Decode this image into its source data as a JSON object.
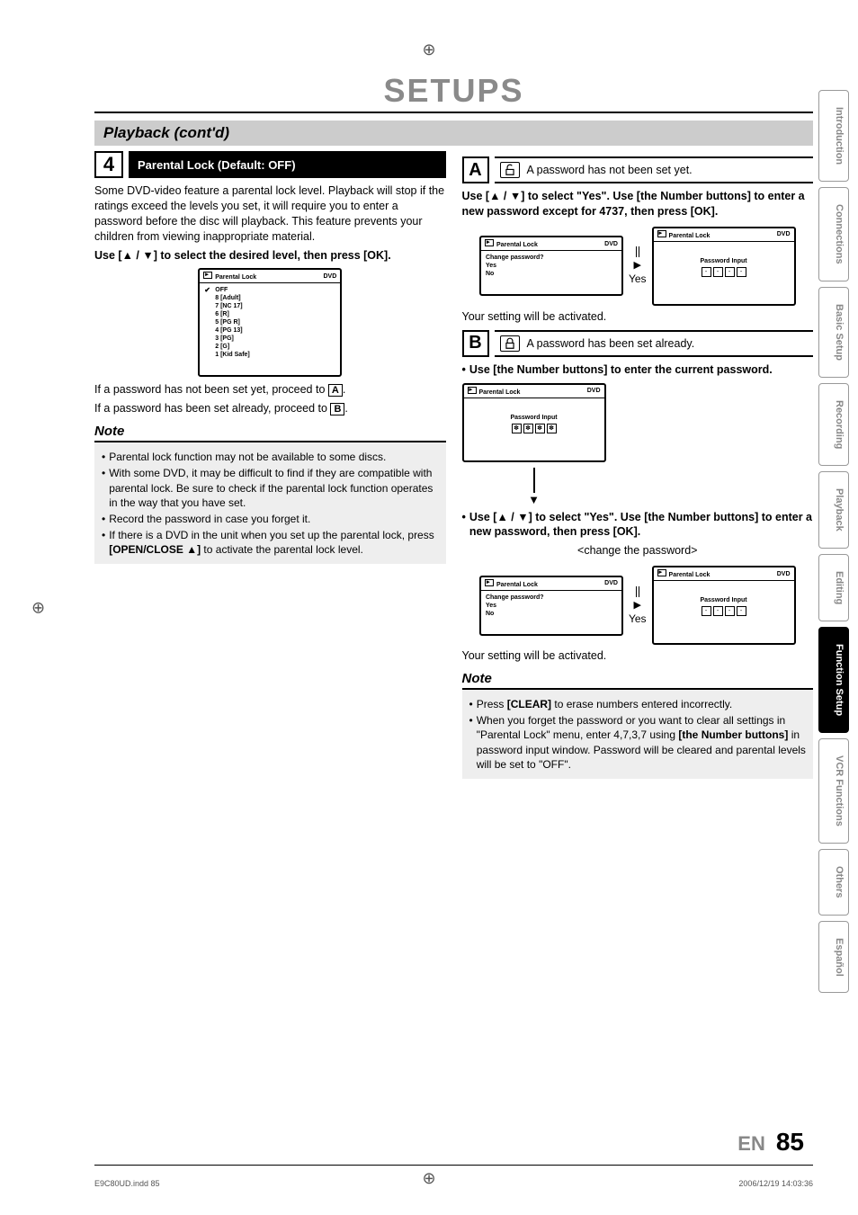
{
  "title": "SETUPS",
  "section": "Playback (cont'd)",
  "step4": {
    "num": "4",
    "header": "Parental Lock (Default: OFF)",
    "para1": "Some DVD-video feature a parental lock level. Playback will stop if the ratings exceed the levels you set, it will require you to enter a password before the disc will playback. This feature prevents your children from viewing inappropriate material.",
    "instr1": "Use [▲ / ▼] to select the desired level, then press [OK].",
    "osd": {
      "title": "Parental Lock",
      "badge": "DVD",
      "items": [
        "OFF",
        "8 [Adult]",
        "7 [NC 17]",
        "6 [R]",
        "5 [PG R]",
        "4 [PG 13]",
        "3 [PG]",
        "2 [G]",
        "1 [Kid Safe]"
      ]
    },
    "line_a": "If a password has not been set yet, proceed to ",
    "ref_a": "A",
    "line_b": "If a password has been set already, proceed to ",
    "ref_b": "B"
  },
  "note1": {
    "header": "Note",
    "items": [
      "Parental lock function may not be available to some discs.",
      "With some DVD, it may be difficult to find if they are compatible with parental lock. Be sure to check if the parental lock function operates in the way that you have set.",
      "Record the password in case you forget it.",
      "If there is a DVD in the unit when you set up the parental lock, press [OPEN/CLOSE ▲] to activate the parental lock level."
    ],
    "bold_inline": "[OPEN/CLOSE ▲]"
  },
  "boxA": {
    "letter": "A",
    "text": "A password has not been set yet.",
    "instr": "Use [▲ / ▼] to select \"Yes\". Use [the Number buttons] to enter a new password except for 4737, then press [OK].",
    "osd_left": {
      "title": "Parental Lock",
      "badge": "DVD",
      "q": "Change password?",
      "yes": "Yes",
      "no": "No"
    },
    "arrow_label": "Yes",
    "osd_right": {
      "title": "Parental Lock",
      "badge": "DVD",
      "pw": "Password Input",
      "slots": [
        "-",
        "-",
        "-",
        "-"
      ]
    },
    "after": "Your setting will be activated."
  },
  "boxB": {
    "letter": "B",
    "text": "A password has been set already.",
    "bullet1": "Use [the Number buttons] to enter the current password.",
    "osd_pw": {
      "title": "Parental Lock",
      "badge": "DVD",
      "pw": "Password Input",
      "slots": [
        "✽",
        "✽",
        "✽",
        "✽"
      ]
    },
    "bullet2": "Use [▲ / ▼] to select \"Yes\". Use [the Number buttons] to enter a new password, then press [OK].",
    "caption": "<change the password>",
    "osd_left": {
      "title": "Parental Lock",
      "badge": "DVD",
      "q": "Change password?",
      "yes": "Yes",
      "no": "No"
    },
    "arrow_label": "Yes",
    "osd_right": {
      "title": "Parental Lock",
      "badge": "DVD",
      "pw": "Password Input",
      "slots": [
        "-",
        "-",
        "-",
        "-"
      ]
    },
    "after": "Your setting will be activated."
  },
  "note2": {
    "header": "Note",
    "items": [
      "Press [CLEAR] to erase numbers entered incorrectly.",
      "When you forget the password or you want to clear all settings in \"Parental Lock\" menu, enter 4,7,3,7 using [the Number buttons] in password input window. Password will be cleared and parental levels will be set to \"OFF\"."
    ]
  },
  "tabs": [
    "Introduction",
    "Connections",
    "Basic Setup",
    "Recording",
    "Playback",
    "Editing",
    "Function Setup",
    "VCR Functions",
    "Others",
    "Español"
  ],
  "active_tab": "Function Setup",
  "footer": {
    "lang": "EN",
    "page": "85"
  },
  "print": {
    "file": "E9C80UD.indd   85",
    "ts": "2006/12/19   14:03:36"
  }
}
